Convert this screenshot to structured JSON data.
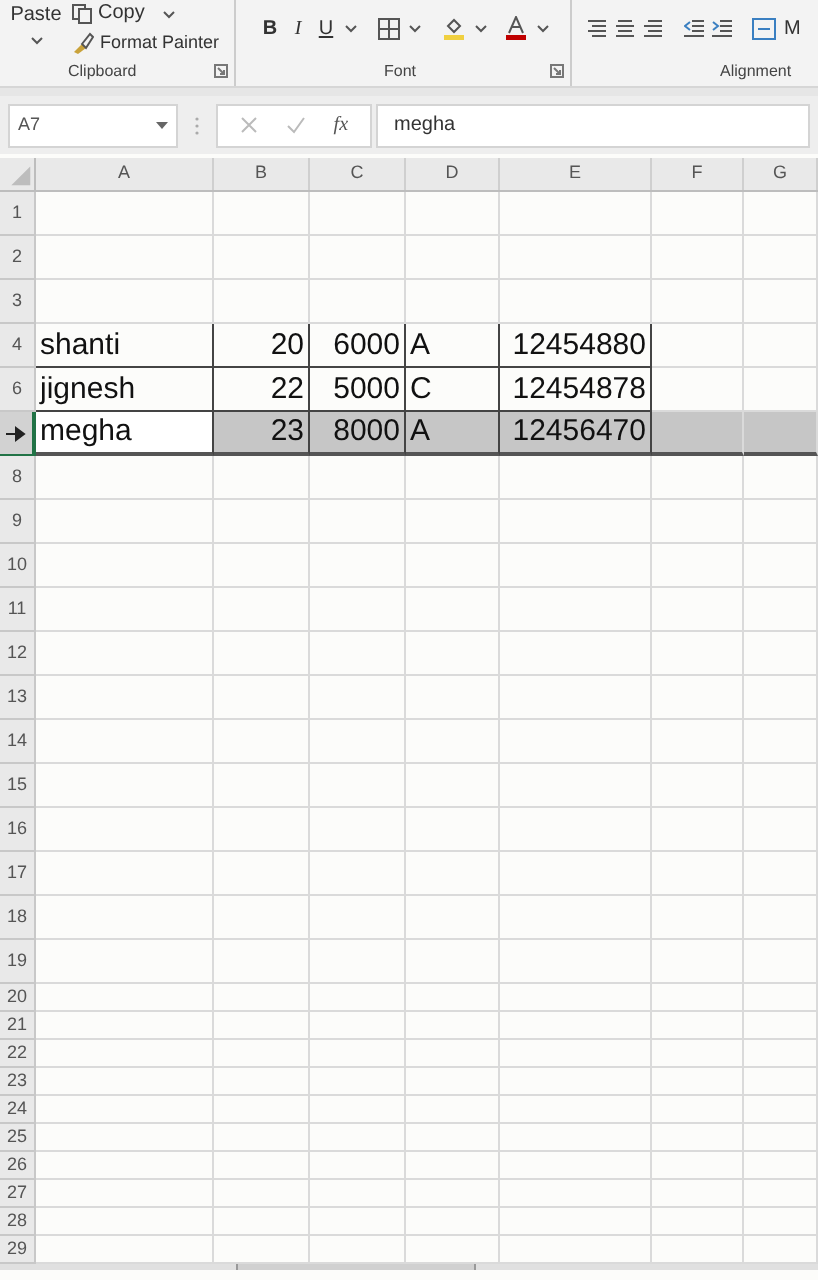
{
  "ribbon": {
    "clipboard": {
      "paste": "Paste",
      "copy": "Copy",
      "format_painter": "Format Painter",
      "label": "Clipboard"
    },
    "font": {
      "bold": "B",
      "italic": "I",
      "underline": "U",
      "label": "Font"
    },
    "alignment": {
      "merge": "M",
      "label": "Alignment"
    }
  },
  "formula_bar": {
    "name_box": "A7",
    "fx": "fx",
    "value": "megha"
  },
  "columns": [
    "A",
    "B",
    "C",
    "D",
    "E",
    "F",
    "G"
  ],
  "rows": [
    {
      "header": "1",
      "selected": false
    },
    {
      "header": "2",
      "selected": false
    },
    {
      "header": "3",
      "selected": false
    },
    {
      "header": "4",
      "selected": false,
      "cells": [
        {
          "text": "shanti",
          "kind": "text"
        },
        {
          "text": "20",
          "kind": "number"
        },
        {
          "text": "6000",
          "kind": "number"
        },
        {
          "text": "A",
          "kind": "text"
        },
        {
          "text": "12454880",
          "kind": "number"
        }
      ]
    },
    {
      "header": "6",
      "selected": false,
      "cells": [
        {
          "text": "jignesh",
          "kind": "text"
        },
        {
          "text": "22",
          "kind": "number"
        },
        {
          "text": "5000",
          "kind": "number"
        },
        {
          "text": "C",
          "kind": "text"
        },
        {
          "text": "12454878",
          "kind": "number"
        }
      ]
    },
    {
      "selected": true,
      "cursor": true,
      "cells": [
        {
          "text": "megha",
          "kind": "text"
        },
        {
          "text": "23",
          "kind": "number"
        },
        {
          "text": "8000",
          "kind": "number"
        },
        {
          "text": "A",
          "kind": "text"
        },
        {
          "text": "12456470",
          "kind": "number"
        }
      ]
    },
    {
      "header": "8",
      "selected": false
    },
    {
      "header": "9",
      "selected": false
    },
    {
      "header": "10",
      "selected": false
    },
    {
      "header": "11",
      "selected": false
    },
    {
      "header": "12",
      "selected": false
    },
    {
      "header": "13",
      "selected": false
    },
    {
      "header": "14",
      "selected": false
    },
    {
      "header": "15",
      "selected": false
    },
    {
      "header": "16",
      "selected": false
    },
    {
      "header": "17",
      "selected": false
    },
    {
      "header": "18",
      "selected": false
    },
    {
      "header": "19",
      "selected": false
    },
    {
      "header": "20",
      "selected": false
    },
    {
      "header": "21",
      "selected": false
    },
    {
      "header": "22",
      "selected": false
    },
    {
      "header": "23",
      "selected": false
    },
    {
      "header": "24",
      "selected": false
    },
    {
      "header": "25",
      "selected": false
    },
    {
      "header": "26",
      "selected": false
    },
    {
      "header": "27",
      "selected": false
    },
    {
      "header": "28",
      "selected": false
    },
    {
      "header": "29",
      "selected": false
    }
  ]
}
